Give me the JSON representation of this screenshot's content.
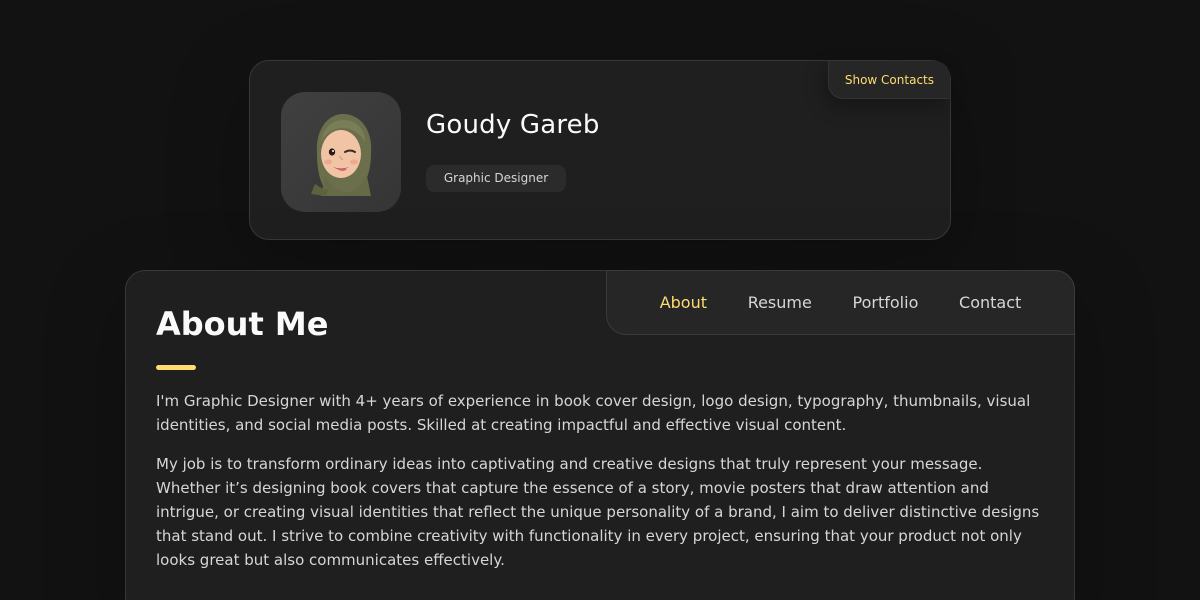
{
  "profile": {
    "name": "Goudy Gareb",
    "title": "Graphic Designer",
    "show_contacts_label": "Show Contacts"
  },
  "navbar": {
    "items": [
      {
        "label": "About",
        "active": true
      },
      {
        "label": "Resume",
        "active": false
      },
      {
        "label": "Portfolio",
        "active": false
      },
      {
        "label": "Contact",
        "active": false
      }
    ]
  },
  "about": {
    "title": "About Me",
    "paragraphs": [
      "I'm Graphic Designer with 4+ years of experience in book cover design, logo design, typography, thumbnails, visual identities, and social media posts. Skilled at creating impactful and effective visual content.",
      "My job is to transform ordinary ideas into captivating and creative designs that truly represent your message. Whether it’s designing book covers that capture the essence of a story, movie posters that draw attention and intrigue, or creating visual identities that reflect the unique personality of a brand, I aim to deliver distinctive designs that stand out. I strive to combine creativity with functionality in every project, ensuring that your product not only looks great but also communicates effectively."
    ]
  },
  "colors": {
    "accent": "#ffdb70",
    "background": "#121212",
    "card": "#1f1f1f"
  }
}
